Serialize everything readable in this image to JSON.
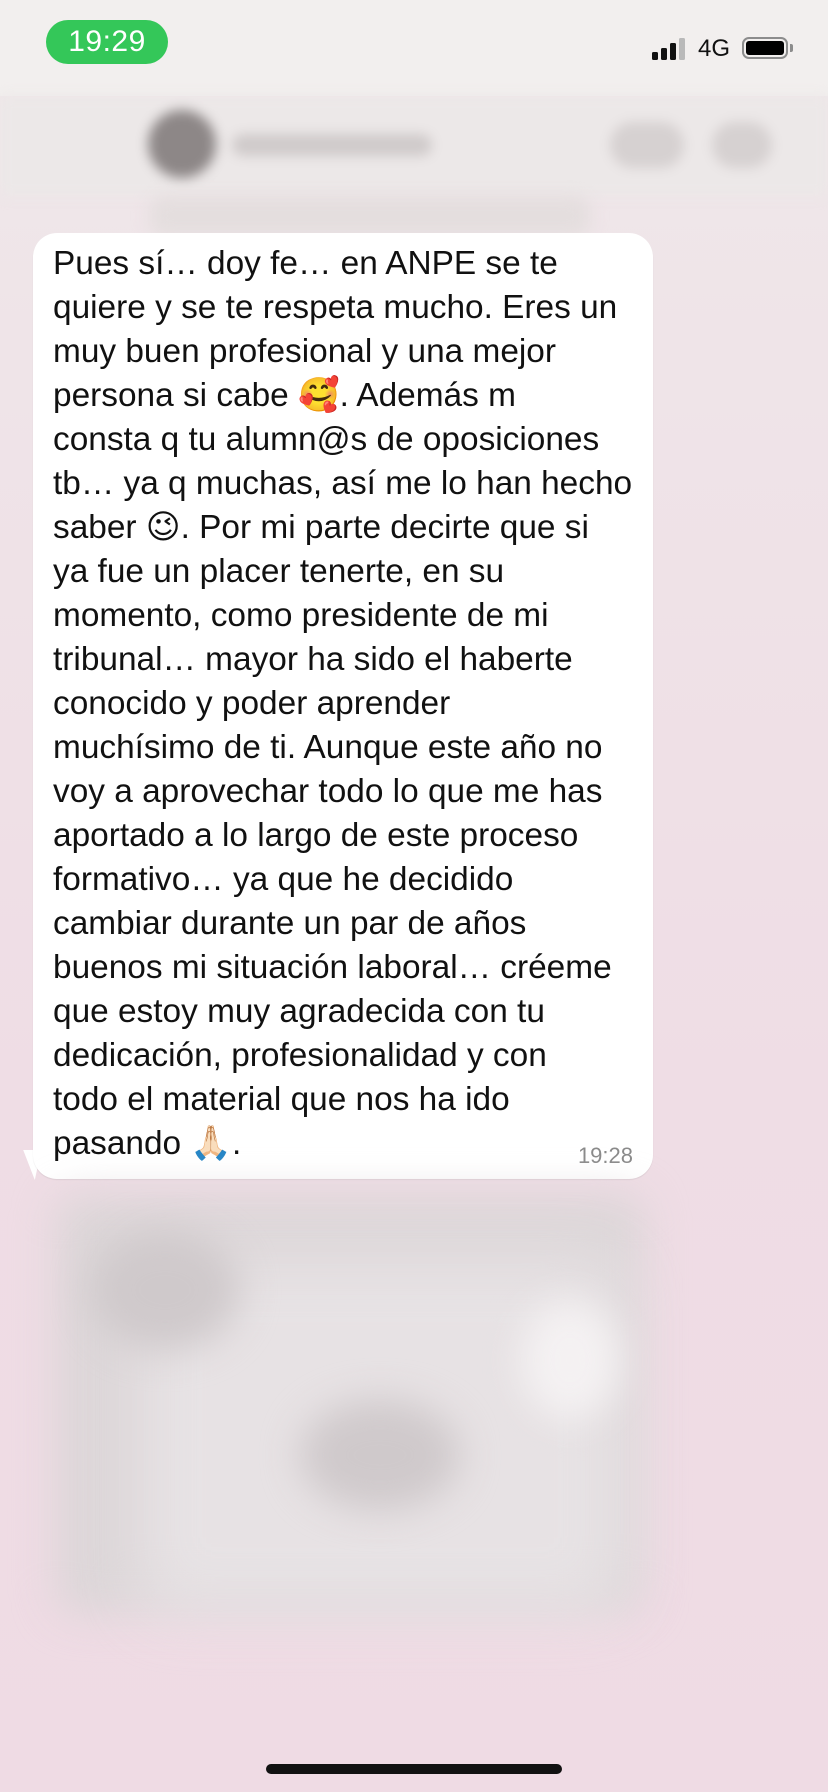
{
  "status_bar": {
    "time": "19:29",
    "network": "4G",
    "signal_icon": "cellular-signal-icon",
    "battery_icon": "battery-icon",
    "time_pill_color": "#34c759"
  },
  "message": {
    "text": "Pues sí… doy fe… en ANPE se te\nquiere y se te respeta mucho. Eres un\nmuy buen profesional y una mejor\npersona si cabe 🥰. Además m\nconsta q tu alumn@s de oposiciones\ntb… ya q muchas, así me lo han hecho\nsaber 😉. Por mi parte decirte que si\nya fue un placer tenerte, en su\nmomento, como presidente de mi\ntribunal… mayor ha sido el haberte\nconocido y poder aprender\nmuchísimo de ti. Aunque este año no\nvoy a aprovechar todo lo que me has\naportado a lo largo de este proceso\nformativo… ya que he decidido\ncambiar durante un par de años\nbuenos mi situación laboral… créeme\nque estoy muy agradecida con tu\ndedicación, profesionalidad y con\ntodo el material que nos ha ido\npasando 🙏🏻.",
    "time": "19:28"
  }
}
